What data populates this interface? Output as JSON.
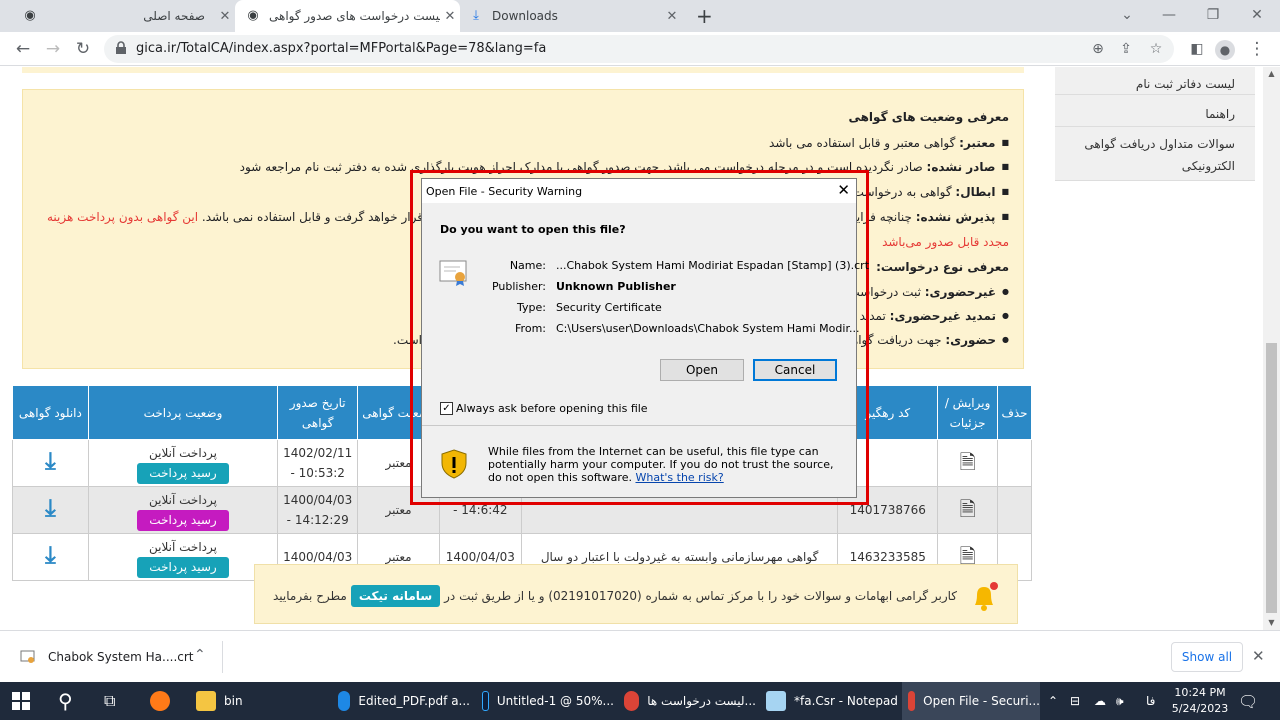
{
  "browser": {
    "tabs": [
      {
        "title": "صفحه اصلی"
      },
      {
        "title": "لیست درخواست های صدور گواهی"
      },
      {
        "title": "Downloads"
      }
    ],
    "url": "gica.ir/TotalCA/index.aspx?portal=MFPortal&Page=78&lang=fa"
  },
  "sidebar": {
    "items": [
      {
        "label": "لیست دفاتر ثبت نام"
      },
      {
        "label": "راهنما"
      },
      {
        "label": "سوالات متداول دریافت گواهی الکترونیکی"
      }
    ]
  },
  "info": {
    "status_heading": "معرفی وضعیت های گواهی",
    "valid_label": "معتبر:",
    "valid_text": "گواهی معتبر و قابل استفاده می باشد",
    "not_issued_label": "صادر نشده:",
    "not_issued_text": "صادر نگردیده است و در مرحله درخواست می باشد. جهت صدور گواهی با مدارک احراز هویت بارگذاری شده به دفتر ثبت نام مراجعه شود",
    "revoked_label": "ابطال:",
    "revoked_text": "گواهی به درخواست م",
    "rejected_label": "پذیرش نشده:",
    "rejected_text": "چنانچه فرایند",
    "rejected_text_end": "قرار خواهد گرفت و قابل استفاده نمی باشد.",
    "rejected_red": "این گواهی بدون پرداخت هزینه",
    "rejected_red2": "مجدد قابل صدور می‌باشد",
    "type_heading": "معرفی نوع درخواست:",
    "online_label": "غیرحضوری:",
    "online_text": "ثبت درخواست گ",
    "renew_label": "تمدید غیرحضوری:",
    "renew_text": "تمدید گوا",
    "inperson_label": "حضوری:",
    "inperson_text": "جهت دریافت گواهی",
    "inperson_end": "است."
  },
  "table": {
    "headers": {
      "delete": "حذف",
      "edit": "ویرایش / جزئیات",
      "tracking": "کد رهگیر",
      "cert_type": "نوع گواهی",
      "issue_date": "تاریخ صدور گواهی",
      "cert_status": "وضعیت گواهی",
      "pay_status": "وضعیت پرداخت",
      "download": "دانلود گواهی"
    },
    "rows": [
      {
        "tracking": "",
        "title": "",
        "date2": "",
        "time2": "",
        "status": "معتبر",
        "date": "1402/02/11",
        "time": "10:53:2 -",
        "pay": "پرداخت آنلاین",
        "receipt": "رسید پرداخت"
      },
      {
        "tracking": "1401738766",
        "title": "",
        "date2": "",
        "time2": "14:6:42 -",
        "status": "معتبر",
        "date": "1400/04/03",
        "time": "14:12:29 -",
        "pay": "پرداخت آنلاین",
        "receipt": "رسید پرداخت"
      },
      {
        "tracking": "1463233585",
        "title": "گواهی مهرسازمانی وابسته به غیردولت با اعتبار دو سال",
        "date2": "1400/04/03",
        "time2": "",
        "status": "معتبر",
        "date": "1400/04/03",
        "time": "",
        "pay": "پرداخت آنلاین",
        "receipt": "رسید پرداخت"
      }
    ]
  },
  "notice": {
    "text_before": "کاربر گرامی ابهامات و سوالات خود را با مرکز تماس به شماره (02191017020) و یا از طریق ثبت در",
    "ticket": "سامانه تیکت",
    "text_after": "مطرح بفرمایید"
  },
  "dialog": {
    "title": "Open File - Security Warning",
    "question": "Do you want to open this file?",
    "name_label": "Name:",
    "name_value": "...Chabok System Hami Modiriat Espadan [Stamp] (3).crt",
    "publisher_label": "Publisher:",
    "publisher_value": "Unknown Publisher",
    "type_label": "Type:",
    "type_value": "Security Certificate",
    "from_label": "From:",
    "from_value": "C:\\Users\\user\\Downloads\\Chabok System Hami Modir...",
    "open": "Open",
    "cancel": "Cancel",
    "always_ask": "Always ask before opening this file",
    "warning": "While files from the Internet can be useful, this file type can potentially harm your computer. If you do not trust the source, do not open this software.",
    "risk_link": "What's the risk?"
  },
  "download_bar": {
    "file": "Chabok System Ha....crt",
    "show_all": "Show all"
  },
  "taskbar": {
    "apps": [
      {
        "label": "bin"
      },
      {
        "label": "Edited_PDF.pdf a..."
      },
      {
        "label": "Untitled-1 @ 50%..."
      },
      {
        "label": "لیست درخواست ها..."
      },
      {
        "label": "*fa.Csr - Notepad"
      },
      {
        "label": "Open File - Securi..."
      }
    ],
    "lang": "فا",
    "time": "10:24 PM",
    "date": "5/24/2023"
  },
  "colors": {
    "header_blue": "#2b89c6",
    "teal_button": "#17a2b8",
    "purple_button": "#c51bc0",
    "warning_red": "#e00000"
  }
}
